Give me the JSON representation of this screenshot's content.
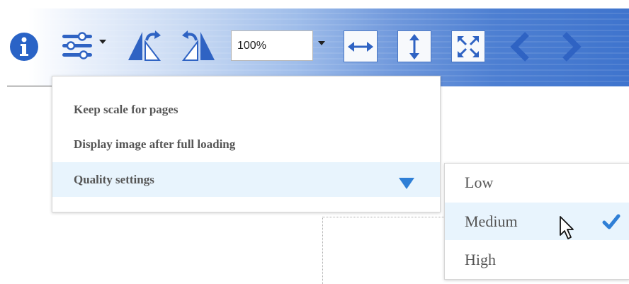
{
  "toolbar": {
    "zoom_value": "100%",
    "icons": [
      "info-icon",
      "settings-sliders-icon",
      "dropdown-caret-icon",
      "rotate-left-icon",
      "rotate-right-icon",
      "zoom-dropdown-caret-icon",
      "fit-width-icon",
      "fit-height-icon",
      "fit-page-icon",
      "previous-icon",
      "next-icon"
    ],
    "accent_color": "#2f63c3"
  },
  "settings_menu": {
    "items": [
      {
        "label": "Keep scale for pages"
      },
      {
        "label": "Display image after full loading"
      },
      {
        "label": "Quality settings"
      }
    ]
  },
  "quality_submenu": {
    "options": [
      {
        "label": "Low"
      },
      {
        "label": "Medium"
      },
      {
        "label": "High"
      }
    ],
    "selected": "Medium"
  }
}
